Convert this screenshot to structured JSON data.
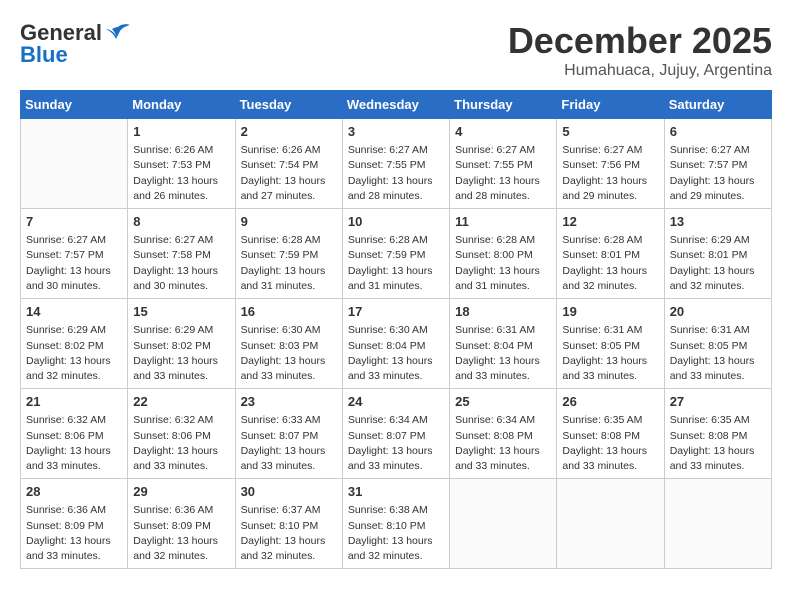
{
  "header": {
    "logo_general": "General",
    "logo_blue": "Blue",
    "month": "December 2025",
    "location": "Humahuaca, Jujuy, Argentina"
  },
  "weekdays": [
    "Sunday",
    "Monday",
    "Tuesday",
    "Wednesday",
    "Thursday",
    "Friday",
    "Saturday"
  ],
  "weeks": [
    [
      {
        "day": "",
        "info": ""
      },
      {
        "day": "1",
        "info": "Sunrise: 6:26 AM\nSunset: 7:53 PM\nDaylight: 13 hours\nand 26 minutes."
      },
      {
        "day": "2",
        "info": "Sunrise: 6:26 AM\nSunset: 7:54 PM\nDaylight: 13 hours\nand 27 minutes."
      },
      {
        "day": "3",
        "info": "Sunrise: 6:27 AM\nSunset: 7:55 PM\nDaylight: 13 hours\nand 28 minutes."
      },
      {
        "day": "4",
        "info": "Sunrise: 6:27 AM\nSunset: 7:55 PM\nDaylight: 13 hours\nand 28 minutes."
      },
      {
        "day": "5",
        "info": "Sunrise: 6:27 AM\nSunset: 7:56 PM\nDaylight: 13 hours\nand 29 minutes."
      },
      {
        "day": "6",
        "info": "Sunrise: 6:27 AM\nSunset: 7:57 PM\nDaylight: 13 hours\nand 29 minutes."
      }
    ],
    [
      {
        "day": "7",
        "info": "Sunrise: 6:27 AM\nSunset: 7:57 PM\nDaylight: 13 hours\nand 30 minutes."
      },
      {
        "day": "8",
        "info": "Sunrise: 6:27 AM\nSunset: 7:58 PM\nDaylight: 13 hours\nand 30 minutes."
      },
      {
        "day": "9",
        "info": "Sunrise: 6:28 AM\nSunset: 7:59 PM\nDaylight: 13 hours\nand 31 minutes."
      },
      {
        "day": "10",
        "info": "Sunrise: 6:28 AM\nSunset: 7:59 PM\nDaylight: 13 hours\nand 31 minutes."
      },
      {
        "day": "11",
        "info": "Sunrise: 6:28 AM\nSunset: 8:00 PM\nDaylight: 13 hours\nand 31 minutes."
      },
      {
        "day": "12",
        "info": "Sunrise: 6:28 AM\nSunset: 8:01 PM\nDaylight: 13 hours\nand 32 minutes."
      },
      {
        "day": "13",
        "info": "Sunrise: 6:29 AM\nSunset: 8:01 PM\nDaylight: 13 hours\nand 32 minutes."
      }
    ],
    [
      {
        "day": "14",
        "info": "Sunrise: 6:29 AM\nSunset: 8:02 PM\nDaylight: 13 hours\nand 32 minutes."
      },
      {
        "day": "15",
        "info": "Sunrise: 6:29 AM\nSunset: 8:02 PM\nDaylight: 13 hours\nand 33 minutes."
      },
      {
        "day": "16",
        "info": "Sunrise: 6:30 AM\nSunset: 8:03 PM\nDaylight: 13 hours\nand 33 minutes."
      },
      {
        "day": "17",
        "info": "Sunrise: 6:30 AM\nSunset: 8:04 PM\nDaylight: 13 hours\nand 33 minutes."
      },
      {
        "day": "18",
        "info": "Sunrise: 6:31 AM\nSunset: 8:04 PM\nDaylight: 13 hours\nand 33 minutes."
      },
      {
        "day": "19",
        "info": "Sunrise: 6:31 AM\nSunset: 8:05 PM\nDaylight: 13 hours\nand 33 minutes."
      },
      {
        "day": "20",
        "info": "Sunrise: 6:31 AM\nSunset: 8:05 PM\nDaylight: 13 hours\nand 33 minutes."
      }
    ],
    [
      {
        "day": "21",
        "info": "Sunrise: 6:32 AM\nSunset: 8:06 PM\nDaylight: 13 hours\nand 33 minutes."
      },
      {
        "day": "22",
        "info": "Sunrise: 6:32 AM\nSunset: 8:06 PM\nDaylight: 13 hours\nand 33 minutes."
      },
      {
        "day": "23",
        "info": "Sunrise: 6:33 AM\nSunset: 8:07 PM\nDaylight: 13 hours\nand 33 minutes."
      },
      {
        "day": "24",
        "info": "Sunrise: 6:34 AM\nSunset: 8:07 PM\nDaylight: 13 hours\nand 33 minutes."
      },
      {
        "day": "25",
        "info": "Sunrise: 6:34 AM\nSunset: 8:08 PM\nDaylight: 13 hours\nand 33 minutes."
      },
      {
        "day": "26",
        "info": "Sunrise: 6:35 AM\nSunset: 8:08 PM\nDaylight: 13 hours\nand 33 minutes."
      },
      {
        "day": "27",
        "info": "Sunrise: 6:35 AM\nSunset: 8:08 PM\nDaylight: 13 hours\nand 33 minutes."
      }
    ],
    [
      {
        "day": "28",
        "info": "Sunrise: 6:36 AM\nSunset: 8:09 PM\nDaylight: 13 hours\nand 33 minutes."
      },
      {
        "day": "29",
        "info": "Sunrise: 6:36 AM\nSunset: 8:09 PM\nDaylight: 13 hours\nand 32 minutes."
      },
      {
        "day": "30",
        "info": "Sunrise: 6:37 AM\nSunset: 8:10 PM\nDaylight: 13 hours\nand 32 minutes."
      },
      {
        "day": "31",
        "info": "Sunrise: 6:38 AM\nSunset: 8:10 PM\nDaylight: 13 hours\nand 32 minutes."
      },
      {
        "day": "",
        "info": ""
      },
      {
        "day": "",
        "info": ""
      },
      {
        "day": "",
        "info": ""
      }
    ]
  ]
}
